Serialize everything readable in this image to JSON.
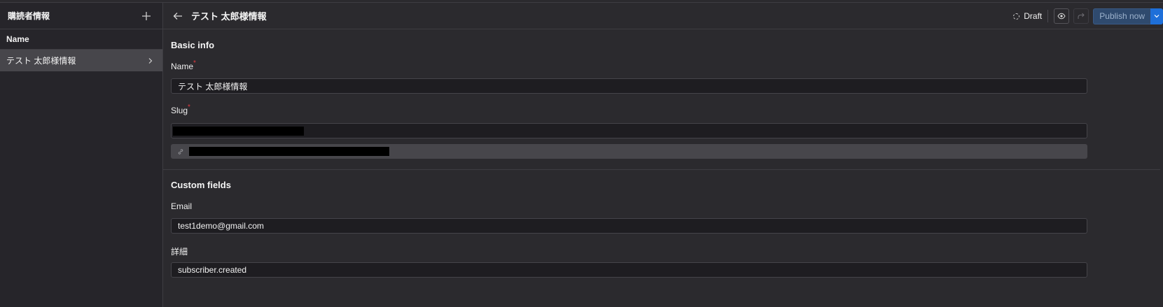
{
  "sidebar": {
    "title": "購読者情報",
    "column_header": "Name",
    "items": [
      {
        "label": "テスト 太郎様情報"
      }
    ]
  },
  "topbar": {
    "title": "テスト 太郎様情報",
    "status": "Draft",
    "publish_label": "Publish now"
  },
  "basic_info": {
    "section_title": "Basic info",
    "name_label": "Name",
    "name_value": "テスト 太郎様情報",
    "slug_label": "Slug",
    "required_mark": "*"
  },
  "custom_fields": {
    "section_title": "Custom fields",
    "email_label": "Email",
    "email_value": "test1demo@gmail.com",
    "detail_label": "詳細",
    "detail_value": "subscriber.created"
  },
  "icons": {
    "add": "plus-icon",
    "chevron": "chevron-right-icon",
    "back": "arrow-left-icon",
    "status": "dashed-circle-icon",
    "preview": "eye-icon",
    "redo": "redo-arrow-icon",
    "caret": "chevron-down-icon",
    "link": "link-icon"
  },
  "colors": {
    "background": "#2b2a2e",
    "sidebar": "#26252a",
    "selected": "#47464b",
    "accent": "#1e6fd9",
    "required": "#e0383e"
  }
}
